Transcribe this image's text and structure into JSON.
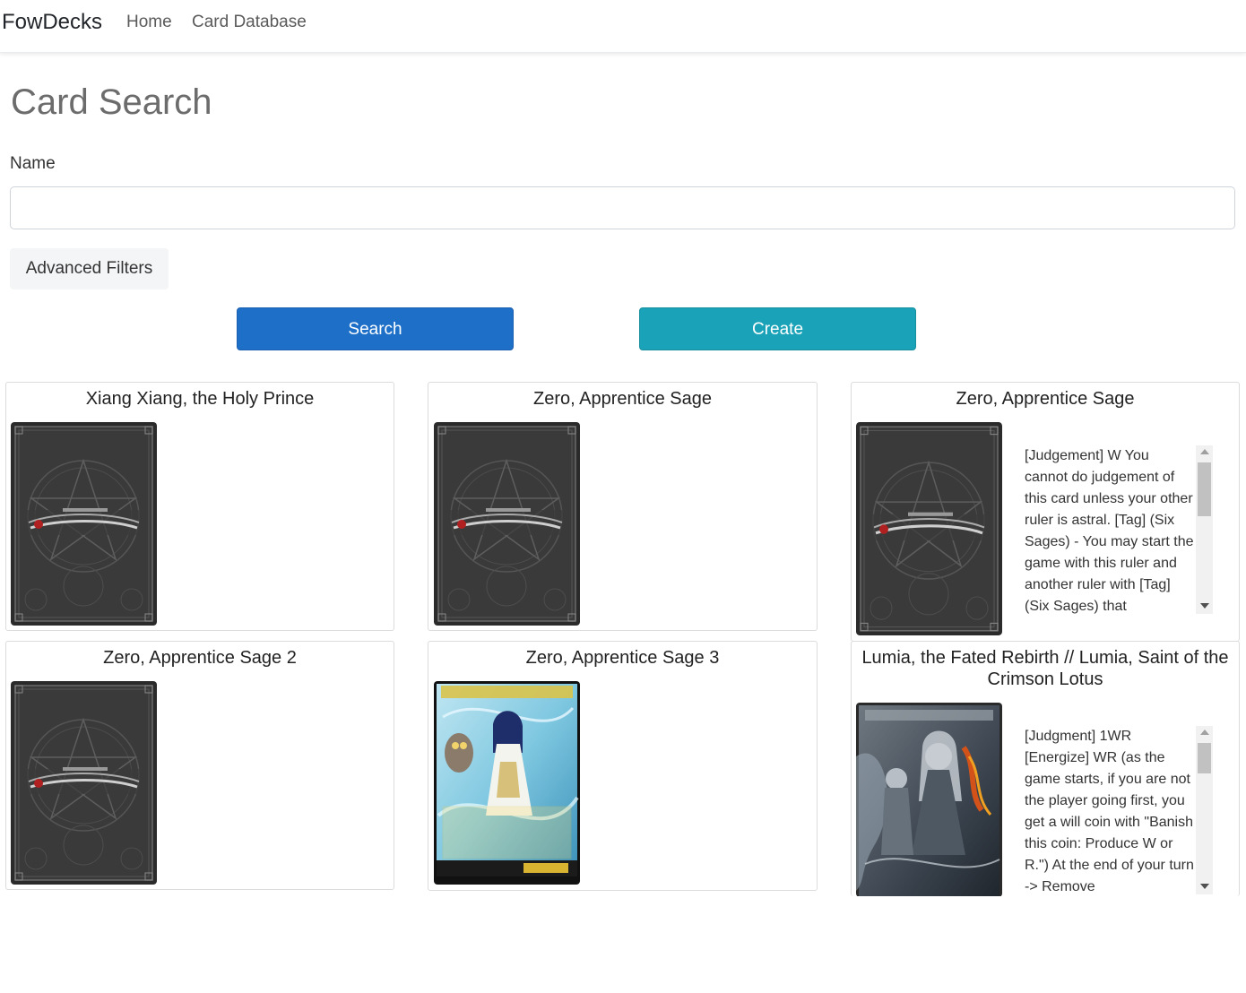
{
  "nav": {
    "brand": "FowDecks",
    "links": [
      "Home",
      "Card Database"
    ]
  },
  "page": {
    "title": "Card Search",
    "name_label": "Name",
    "name_value": "",
    "name_placeholder": "",
    "advanced_filters": "Advanced Filters",
    "search_button": "Search",
    "create_button": "Create"
  },
  "colors": {
    "search": "#1e6fc8",
    "create": "#1aa3b8"
  },
  "cards": [
    {
      "name": "Xiang Xiang, the Holy Prince",
      "image": "card-back",
      "text": ""
    },
    {
      "name": "Zero, Apprentice Sage",
      "image": "card-back",
      "text": ""
    },
    {
      "name": "Zero, Apprentice Sage",
      "image": "card-back",
      "text": "[Judgement] W You cannot do judgement of this card unless your other ruler is astral. [Tag] (Six Sages) - You may start the game with this ruler and another ruler with [Tag] (Six Sages) that"
    },
    {
      "name": "Zero, Apprentice Sage 2",
      "image": "card-back",
      "text": ""
    },
    {
      "name": "Zero, Apprentice Sage 3",
      "image": "card-art-zero",
      "text": ""
    },
    {
      "name": "Lumia, the Fated Rebirth // Lumia, Saint of the Crimson Lotus",
      "image": "card-art-lumia",
      "text": "[Judgment] 1WR [Energize] WR (as the game starts, if you are not the player going first, you get a will coin with \"Banish this coin: Produce W or R.\") At the end of your turn -> Remove"
    }
  ]
}
